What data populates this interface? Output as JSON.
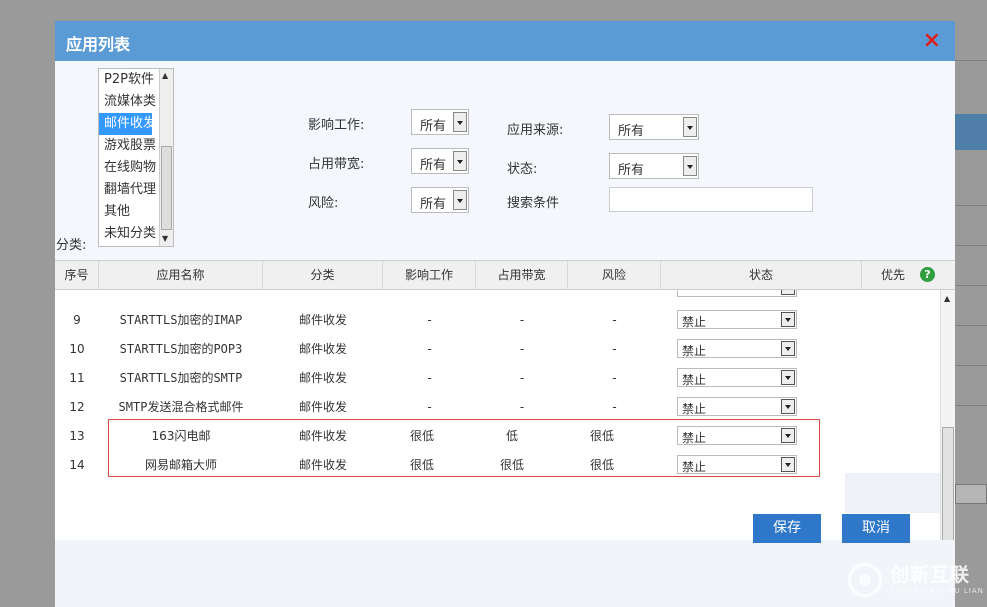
{
  "modal": {
    "title": "应用列表",
    "close_glyph": "×"
  },
  "filters": {
    "category_label": "分类:",
    "categories": [
      "P2P软件",
      "流媒体类",
      "邮件收发",
      "游戏股票",
      "在线购物",
      "翻墙代理",
      "其他",
      "未知分类"
    ],
    "selected_category": "邮件收发",
    "impact_label": "影响工作:",
    "impact_value": "所有",
    "bandwidth_label": "占用带宽:",
    "bandwidth_value": "所有",
    "risk_label": "风险:",
    "risk_value": "所有",
    "source_label": "应用来源:",
    "source_value": "所有",
    "status_label": "状态:",
    "status_value": "所有",
    "search_label": "搜索条件",
    "search_value": ""
  },
  "table": {
    "headers": [
      "序号",
      "应用名称",
      "分类",
      "影响工作",
      "占用带宽",
      "风险",
      "状态",
      "优先"
    ],
    "rows": [
      {
        "no": "9",
        "name": "STARTTLS加密的IMAP",
        "category": "邮件收发",
        "impact": "-",
        "bandwidth": "-",
        "risk": "-",
        "status": "禁止"
      },
      {
        "no": "10",
        "name": "STARTTLS加密的POP3",
        "category": "邮件收发",
        "impact": "-",
        "bandwidth": "-",
        "risk": "-",
        "status": "禁止"
      },
      {
        "no": "11",
        "name": "STARTTLS加密的SMTP",
        "category": "邮件收发",
        "impact": "-",
        "bandwidth": "-",
        "risk": "-",
        "status": "禁止"
      },
      {
        "no": "12",
        "name": "SMTP发送混合格式邮件",
        "category": "邮件收发",
        "impact": "-",
        "bandwidth": "-",
        "risk": "-",
        "status": "禁止"
      },
      {
        "no": "13",
        "name": "163闪电邮",
        "category": "邮件收发",
        "impact": "很低",
        "bandwidth": "低",
        "risk": "很低",
        "status": "禁止"
      },
      {
        "no": "14",
        "name": "网易邮箱大师",
        "category": "邮件收发",
        "impact": "很低",
        "bandwidth": "很低",
        "risk": "很低",
        "status": "禁止"
      }
    ]
  },
  "buttons": {
    "save": "保存",
    "cancel": "取消"
  },
  "watermark": {
    "cn": "创新互联",
    "en": "CHUANG XIN HU LIAN"
  },
  "colors": {
    "header_blue": "#5b9bd5",
    "button_blue": "#2f77c8",
    "highlight_red": "#dd4444",
    "close_red": "#e02020"
  }
}
